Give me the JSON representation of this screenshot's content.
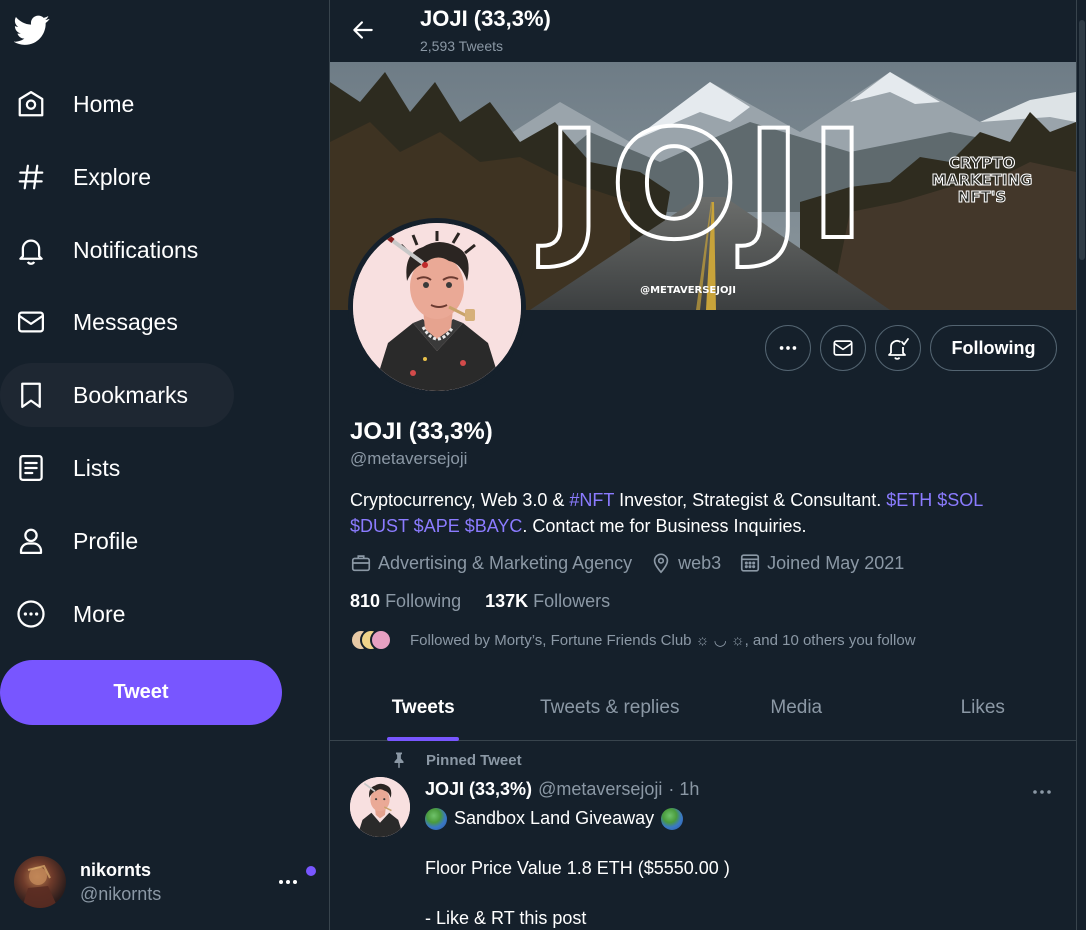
{
  "sidebar": {
    "logo_icon": "twitter-bird-icon",
    "items": [
      {
        "label": "Home",
        "icon": "home-icon"
      },
      {
        "label": "Explore",
        "icon": "hashtag-icon"
      },
      {
        "label": "Notifications",
        "icon": "bell-icon"
      },
      {
        "label": "Messages",
        "icon": "envelope-icon"
      },
      {
        "label": "Bookmarks",
        "icon": "bookmark-icon"
      },
      {
        "label": "Lists",
        "icon": "list-icon"
      },
      {
        "label": "Profile",
        "icon": "person-icon"
      },
      {
        "label": "More",
        "icon": "more-circle-icon"
      }
    ],
    "active_item": "Bookmarks",
    "tweet_button": "Tweet"
  },
  "account": {
    "name": "nikornts",
    "handle": "@nikornts"
  },
  "header": {
    "title": "JOJI (33,3%)",
    "subtitle": "2,593 Tweets"
  },
  "banner": {
    "big_text": "JOJI",
    "side_text": [
      "CRYPTO",
      "MARKETING",
      "NFT'S"
    ],
    "watermark": "@METAVERSEJOJI"
  },
  "profile": {
    "name": "JOJI (33,3%)",
    "handle": "@metaversejoji",
    "follow_button": "Following",
    "bio": {
      "part1": "Cryptocurrency, Web 3.0 & ",
      "tag": "#NFT",
      "part2": " Investor, Strategist & Consultant. ",
      "cashtags_line1": "$ETH $SOL",
      "cashtags_line2": "$DUST $APE $BAYC",
      "part3": ". Contact me for Business Inquiries."
    },
    "category": "Advertising & Marketing Agency",
    "location": "web3",
    "joined": "Joined May 2021",
    "following_count": "810",
    "following_label": "Following",
    "followers_count": "137K",
    "followers_label": "Followers",
    "followed_by": "Followed by Morty’s, Fortune Friends Club ☼ ◡ ☼, and 10 others you follow"
  },
  "tabs": [
    {
      "label": "Tweets",
      "active": true
    },
    {
      "label": "Tweets & replies",
      "active": false
    },
    {
      "label": "Media",
      "active": false
    },
    {
      "label": "Likes",
      "active": false
    }
  ],
  "pinned_tweet": {
    "pinned_label": "Pinned Tweet",
    "name": "JOJI (33,3%)",
    "handle": "@metaversejoji",
    "time": "· 1h",
    "lines": [
      "Sandbox Land Giveaway",
      "",
      "Floor Price Value 1.8 ETH ($5550.00 )",
      "",
      "- Like & RT this post"
    ]
  },
  "colors": {
    "background": "#15202b",
    "accent": "#7856ff",
    "secondary_text": "#8b98a5",
    "link": "#8b7bff",
    "border": "#38444d"
  }
}
